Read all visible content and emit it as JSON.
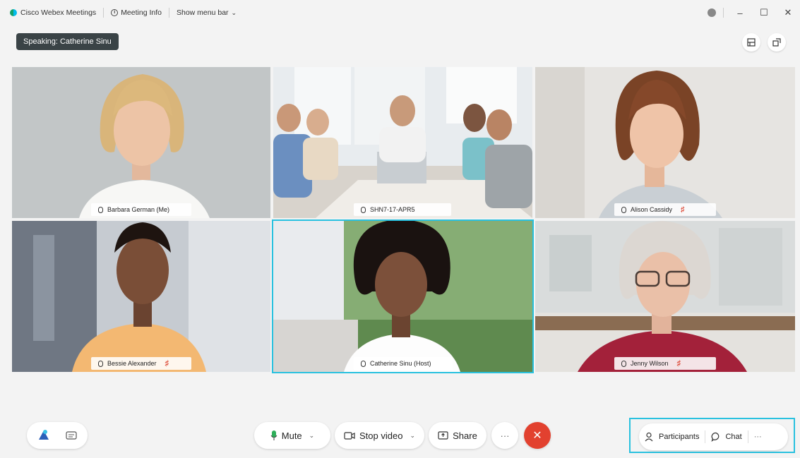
{
  "titlebar": {
    "app_name": "Cisco Webex Meetings",
    "meeting_info": "Meeting Info",
    "show_menu_bar": "Show menu bar",
    "window_buttons": [
      "–",
      "☐",
      "✕"
    ]
  },
  "speaking_label": "Speaking: Catherine Sinu",
  "participants": [
    {
      "name": "Barbara German (Me)",
      "muted": false
    },
    {
      "name": "SHN7-17-APR5",
      "muted": false
    },
    {
      "name": "Alison Cassidy",
      "muted": true
    },
    {
      "name": "Bessie Alexander",
      "muted": true
    },
    {
      "name": "Catherine Sinu (Host)",
      "muted": false,
      "active_speaker": true
    },
    {
      "name": "Jenny Wilson",
      "muted": true
    }
  ],
  "controls": {
    "mute": "Mute",
    "stop_video": "Stop video",
    "share": "Share",
    "more": "···",
    "end": "✕"
  },
  "panel": {
    "participants": "Participants",
    "chat": "Chat",
    "more": "···"
  },
  "colors": {
    "active_outline": "#29c1df",
    "end_call": "#e2412f",
    "speaking_badge": "#3a4346",
    "muted_icon": "#d9341f"
  }
}
